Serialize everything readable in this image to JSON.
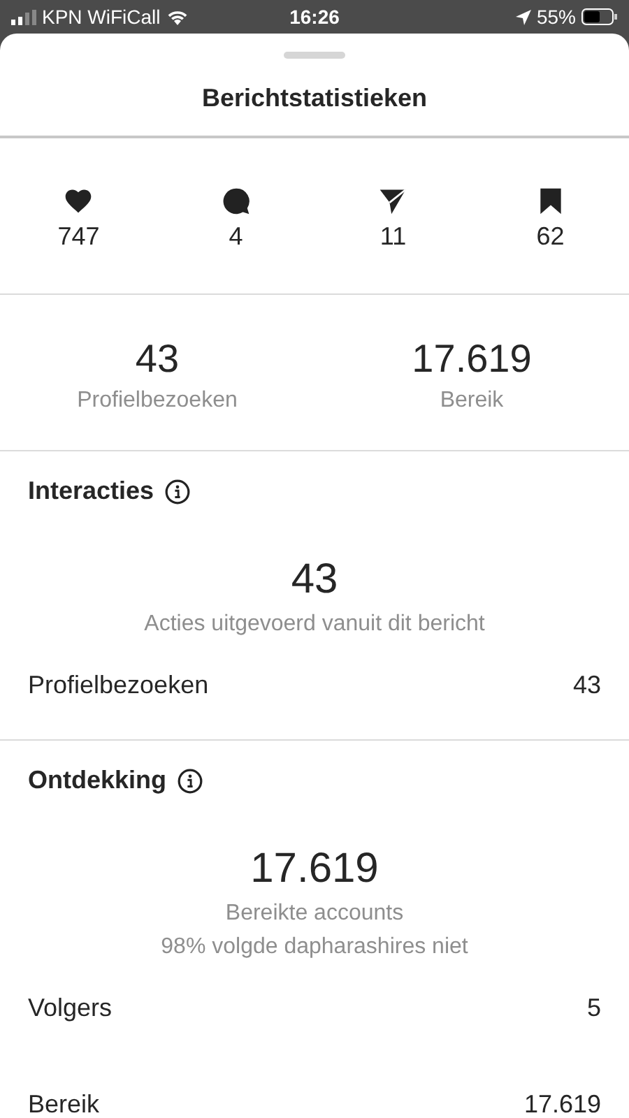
{
  "status_bar": {
    "carrier": "KPN WiFiCall",
    "time": "16:26",
    "battery": "55%"
  },
  "title": "Berichtstatistieken",
  "metrics": [
    {
      "kind": "heart",
      "value": "747"
    },
    {
      "kind": "comment",
      "value": "4"
    },
    {
      "kind": "send",
      "value": "11"
    },
    {
      "kind": "bookmark",
      "value": "62"
    }
  ],
  "summary": [
    {
      "value": "43",
      "label": "Profielbezoeken"
    },
    {
      "value": "17.619",
      "label": "Bereik"
    }
  ],
  "sections": [
    {
      "title": "Interacties",
      "value": "43",
      "captions": [
        "Acties uitgevoerd vanuit dit bericht"
      ],
      "rows": [
        {
          "label": "Profielbezoeken",
          "value": "43"
        }
      ]
    },
    {
      "title": "Ontdekking",
      "value": "17.619",
      "captions": [
        "Bereikte accounts",
        "98% volgde dapharashires niet"
      ],
      "rows": [
        {
          "label": "Volgers",
          "value": "5"
        },
        {
          "label": "Bereik",
          "value": "17.619"
        }
      ]
    }
  ]
}
